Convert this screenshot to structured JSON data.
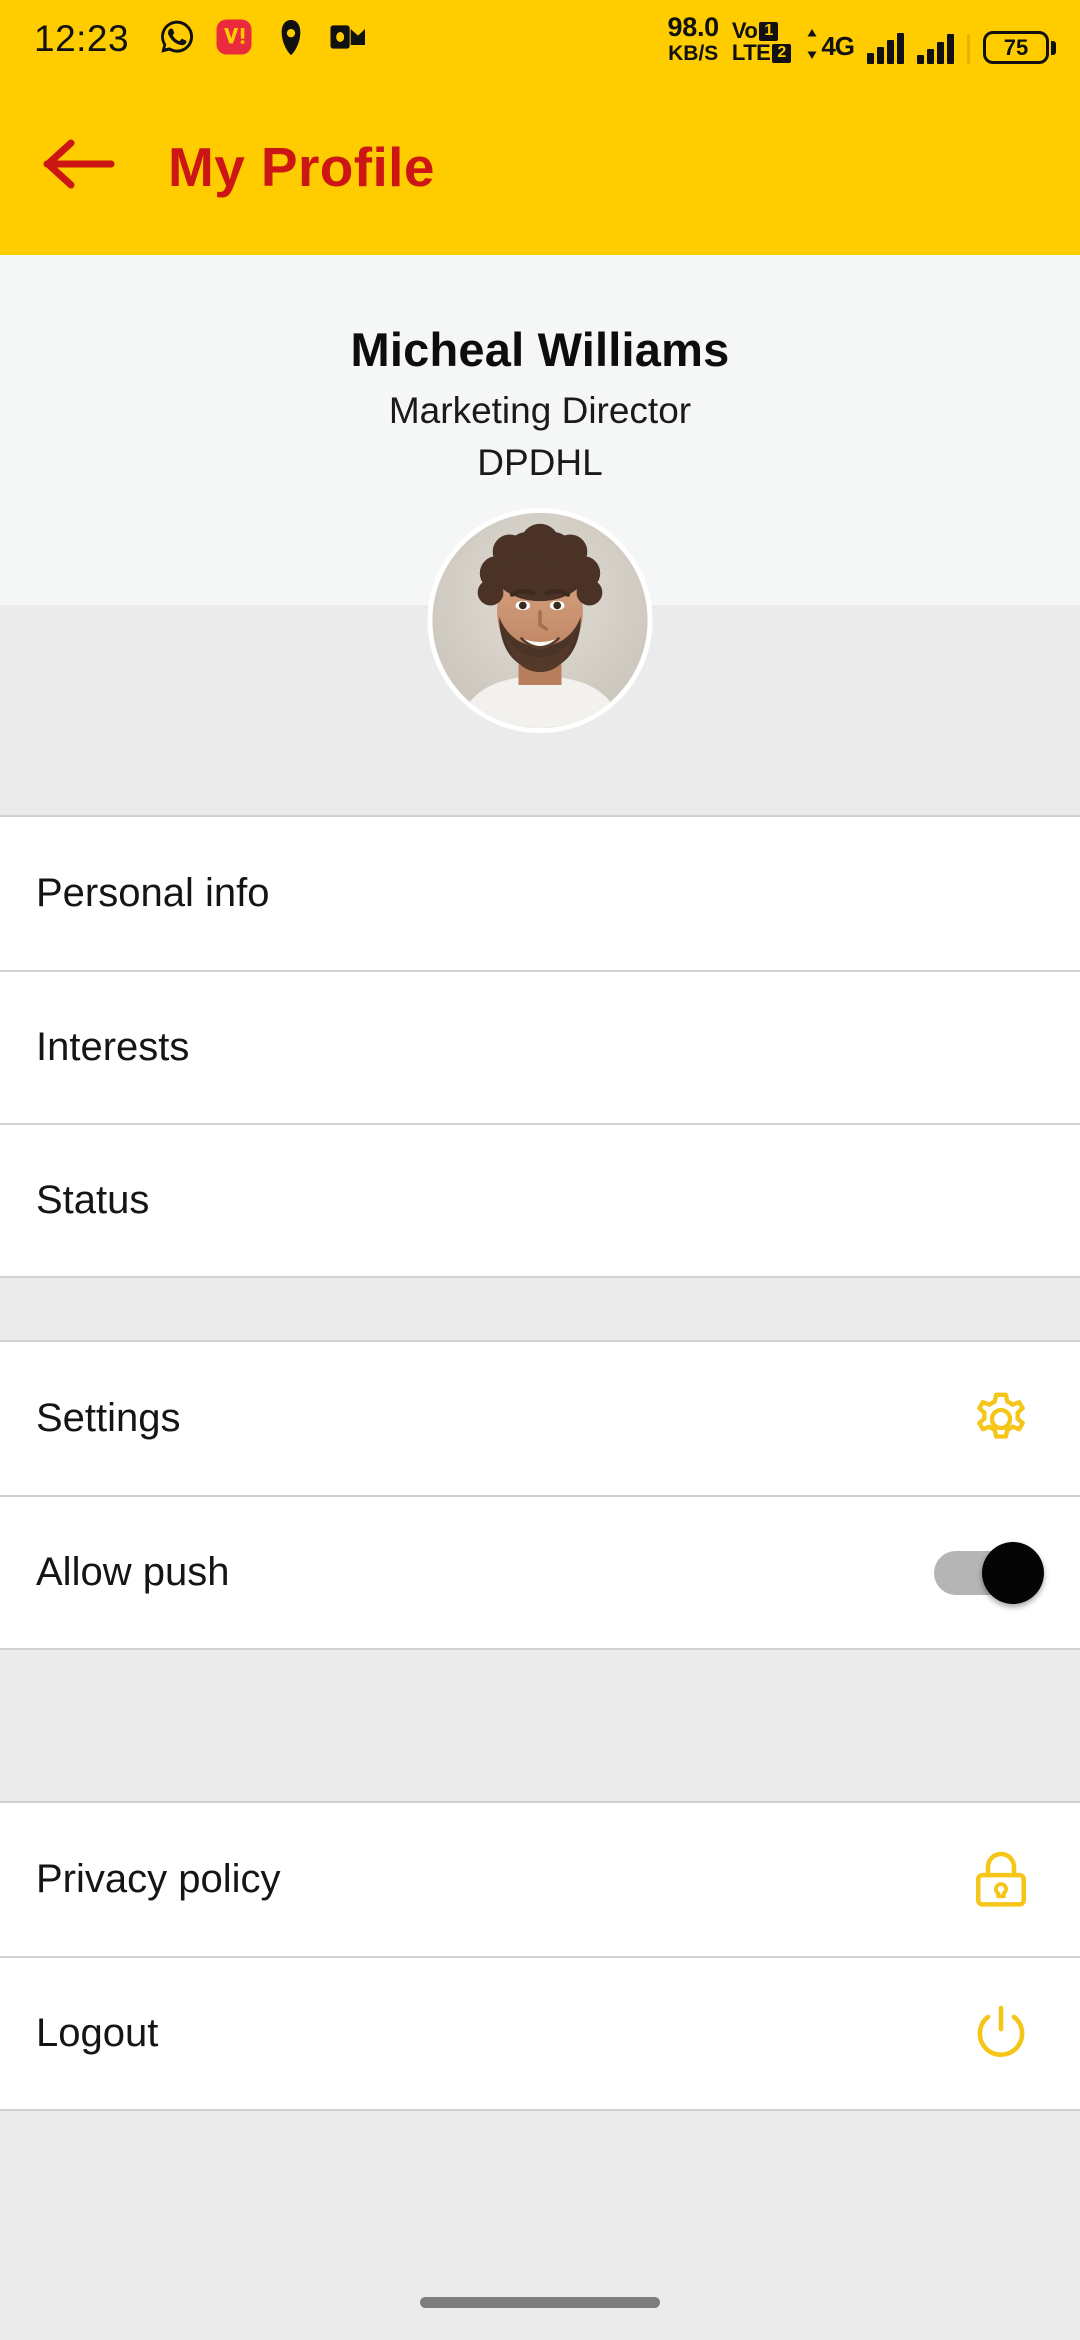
{
  "status_bar": {
    "time": "12:23",
    "left_icons": [
      "whatsapp-icon",
      "vi-icon",
      "phone-icon",
      "outlook-icon"
    ],
    "network_speed_value": "98.0",
    "network_speed_unit": "KB/S",
    "volte_label": "Vo",
    "volte_label2": "LTE",
    "sim1": "1",
    "sim2": "2",
    "network_type": "4G",
    "battery_percent": "75"
  },
  "app_bar": {
    "back_icon": "arrow-left-icon",
    "title": "My Profile",
    "background_color": "#FFCC00",
    "title_color": "#CC1515"
  },
  "profile": {
    "name": "Micheal Williams",
    "role": "Marketing Director",
    "organization": "DPDHL",
    "avatar_alt": "avatar"
  },
  "menu_groups": [
    {
      "items": [
        {
          "label": "Personal info",
          "icon": null
        },
        {
          "label": "Interests",
          "icon": null
        },
        {
          "label": "Status",
          "icon": null
        }
      ]
    },
    {
      "items": [
        {
          "label": "Settings",
          "icon": "gear-icon"
        },
        {
          "label": "Allow push",
          "icon": "toggle-switch",
          "toggle_state": "on"
        }
      ]
    },
    {
      "items": [
        {
          "label": "Privacy policy",
          "icon": "lock-icon"
        },
        {
          "label": "Logout",
          "icon": "power-icon"
        }
      ]
    }
  ],
  "theme": {
    "accent_yellow": "#FFCC00",
    "icon_yellow": "#F5C518",
    "title_red": "#CC1515",
    "page_gray": "#EBEBEB",
    "header_gray": "#F5F6F6",
    "row_white": "#FFFFFF",
    "divider": "#D2D2D2"
  }
}
